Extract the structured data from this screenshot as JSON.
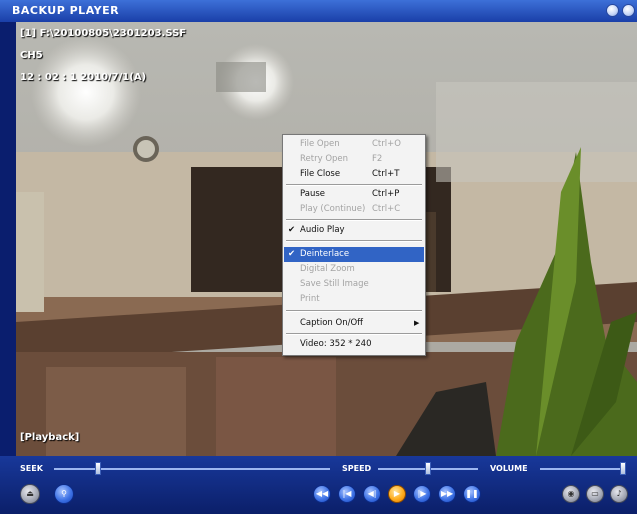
{
  "window": {
    "title": "BACKUP PLAYER"
  },
  "osd": {
    "line1": "[1] F:\\20100805\\2301203.SSF",
    "line2": "CH5",
    "line3": "12 : 02 : 1   2010/7/1(A)",
    "status": "[Playback]"
  },
  "context_menu": {
    "items": [
      {
        "label": "File Open",
        "shortcut": "Ctrl+O",
        "enabled": false,
        "checked": false,
        "highlighted": false
      },
      {
        "label": "Retry Open",
        "shortcut": "F2",
        "enabled": false,
        "checked": false,
        "highlighted": false
      },
      {
        "label": "File Close",
        "shortcut": "Ctrl+T",
        "enabled": true,
        "checked": false,
        "highlighted": false
      },
      {
        "label": "Pause",
        "shortcut": "Ctrl+P",
        "enabled": true,
        "checked": false,
        "highlighted": false
      },
      {
        "label": "Play (Continue)",
        "shortcut": "Ctrl+C",
        "enabled": false,
        "checked": false,
        "highlighted": false
      },
      {
        "label": "Audio Play",
        "shortcut": "",
        "enabled": true,
        "checked": true,
        "highlighted": false
      },
      {
        "label": "Deinterlace",
        "shortcut": "",
        "enabled": true,
        "checked": true,
        "highlighted": true
      },
      {
        "label": "Digital Zoom",
        "shortcut": "",
        "enabled": false,
        "checked": false,
        "highlighted": false
      },
      {
        "label": "Save Still Image",
        "shortcut": "",
        "enabled": false,
        "checked": false,
        "highlighted": false
      },
      {
        "label": "Print",
        "shortcut": "",
        "enabled": false,
        "checked": false,
        "highlighted": false
      },
      {
        "label": "Caption On/Off",
        "shortcut": "",
        "enabled": true,
        "checked": false,
        "highlighted": false,
        "submenu": true
      },
      {
        "label": "Video: 352 * 240",
        "shortcut": "",
        "enabled": true,
        "checked": false,
        "highlighted": false
      }
    ]
  },
  "controls": {
    "seek_label": "SEEK",
    "speed_label": "SPEED",
    "volume_label": "VOLUME",
    "seek_position": 0.16,
    "speed_position": 0.5,
    "volume_position": 1.0,
    "left_buttons": [
      {
        "icon": "eject-icon"
      },
      {
        "icon": "search-icon"
      }
    ],
    "transport_buttons": [
      {
        "icon": "fast-rewind-icon",
        "symbol": "◀◀"
      },
      {
        "icon": "skip-back-icon",
        "symbol": "|◀"
      },
      {
        "icon": "step-back-icon",
        "symbol": "◀|"
      },
      {
        "icon": "play-icon",
        "symbol": "▶",
        "active": true
      },
      {
        "icon": "step-forward-icon",
        "symbol": "|▶"
      },
      {
        "icon": "fast-forward-icon",
        "symbol": "▶▶"
      },
      {
        "icon": "pause-icon",
        "symbol": "❚❚"
      }
    ],
    "right_buttons": [
      {
        "icon": "snapshot-icon"
      },
      {
        "icon": "print-icon"
      },
      {
        "icon": "speaker-icon"
      }
    ]
  },
  "colors": {
    "frame": "#0a1e6e",
    "titlebar": "#1a3fa8",
    "menu_highlight": "#3164c5"
  }
}
